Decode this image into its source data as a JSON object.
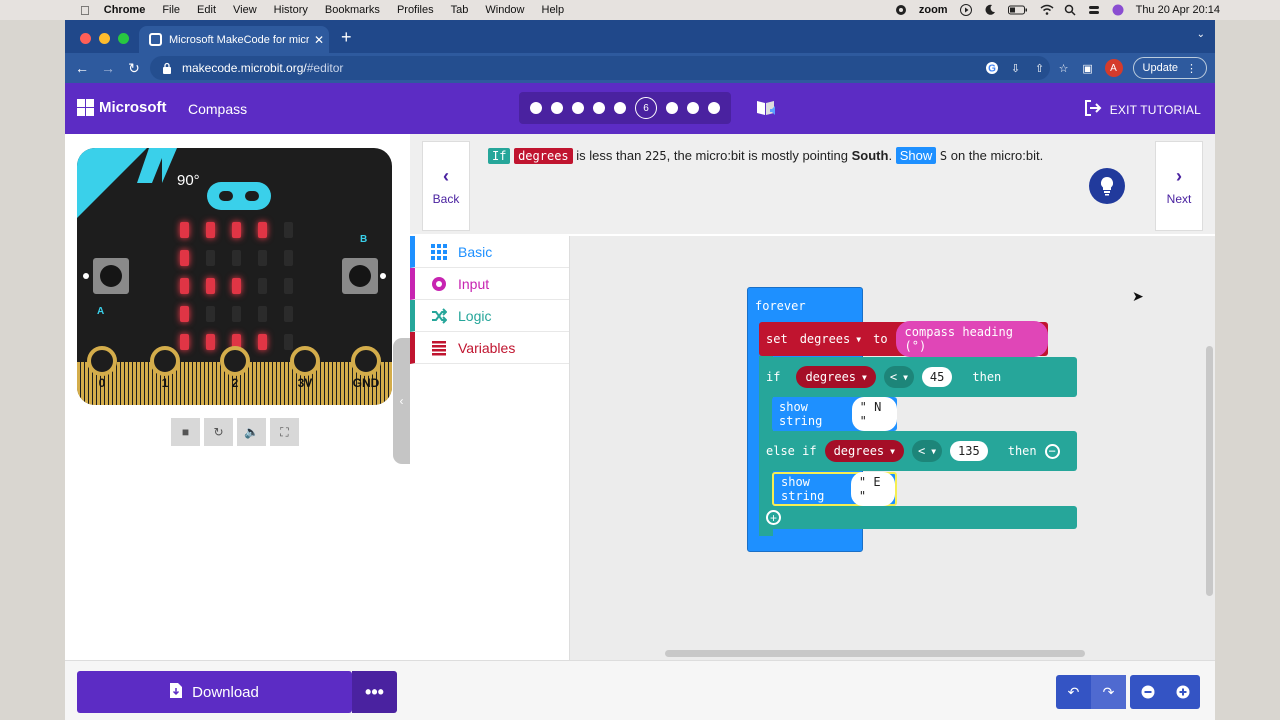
{
  "os_menu": {
    "app": "Chrome",
    "items": [
      "File",
      "Edit",
      "View",
      "History",
      "Bookmarks",
      "Profiles",
      "Tab",
      "Window",
      "Help"
    ],
    "zoom_label": "zoom",
    "datetime": "Thu 20 Apr  20:14"
  },
  "browser": {
    "tab_title": "Microsoft MakeCode for micro",
    "url_host": "makecode.microbit.org/",
    "url_path": "#editor",
    "avatar_letter": "A",
    "update_label": "Update"
  },
  "header": {
    "brand": "Microsoft",
    "project": "Compass",
    "current_step": "6",
    "exit_label": "EXIT TUTORIAL"
  },
  "simulator": {
    "heading_label": "90°",
    "button_a": "A",
    "button_b": "B",
    "pins": [
      "0",
      "1",
      "2",
      "3V",
      "GND"
    ],
    "leds": [
      [
        1,
        1,
        1,
        1,
        0
      ],
      [
        1,
        0,
        0,
        0,
        0
      ],
      [
        1,
        1,
        1,
        0,
        0
      ],
      [
        1,
        0,
        0,
        0,
        0
      ],
      [
        1,
        1,
        1,
        1,
        0
      ]
    ]
  },
  "hint": {
    "back_label": "Back",
    "next_label": "Next",
    "kw_if": "If",
    "kw_degrees": "degrees",
    "t1": "is less than",
    "num": "225",
    "t2": ", the micro:bit is mostly pointing",
    "direction": "South",
    "t3": ".",
    "kw_show": "Show",
    "letter": "S",
    "t4": "on the micro:bit."
  },
  "toolbox": [
    {
      "label": "Basic",
      "color": "#1e90ff"
    },
    {
      "label": "Input",
      "color": "#c724b1"
    },
    {
      "label": "Logic",
      "color": "#26a69a"
    },
    {
      "label": "Variables",
      "color": "#c0142f"
    }
  ],
  "blocks": {
    "forever": "forever",
    "set": "set",
    "var": "degrees",
    "to": "to",
    "compass": "compass heading (°)",
    "if": "if",
    "op": "<",
    "val1": "45",
    "then": "then",
    "show_string": "show string",
    "str1": "\" N \"",
    "else_if": "else if",
    "val2": "135",
    "str2": "\" E \""
  },
  "bottom": {
    "download_label": "Download",
    "more_label": "•••"
  },
  "colors": {
    "header_purple": "#5c2cc4",
    "basic_blue": "#1e90ff",
    "logic_teal": "#26a69a",
    "variables_red": "#c0142f",
    "input_magenta": "#c724b1"
  }
}
